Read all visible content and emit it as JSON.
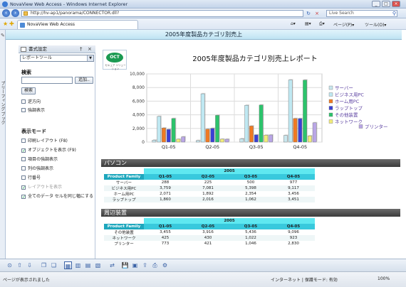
{
  "window": {
    "title": "NovaView Web Access - Windows Internet Explorer"
  },
  "address": {
    "url": "http://hv-ap1/panorama/CONNECTOR.dll?",
    "search_placeholder": "Live Search"
  },
  "tabbar": {
    "tab_label": "NovaView Web Access",
    "page_menu": "ページ(P)",
    "tools_menu": "ツール(O)"
  },
  "header": {
    "title": "2005年度製品カテゴリ別売上"
  },
  "leftstrip": {
    "label": "ブリーフィング ブック"
  },
  "panel": {
    "title": "書式設定",
    "pin": "†",
    "close": "×",
    "select_value": "レポートツール",
    "search_heading": "検索",
    "add_button": "追加..",
    "search_button": "検索",
    "opt_reverse": "逆方向",
    "opt_highlight": "強調表示",
    "mode_heading": "表示モード",
    "modes": [
      {
        "label": "印刷レイアウト (F8)",
        "checked": false,
        "dim": false
      },
      {
        "label": "オブジェクトを表示 (F9)",
        "checked": true,
        "dim": false
      },
      {
        "label": "項目の強調表示",
        "checked": false,
        "dim": false
      },
      {
        "label": "列の強調表示",
        "checked": false,
        "dim": false
      },
      {
        "label": "行番号",
        "checked": false,
        "dim": false
      },
      {
        "label": "レイアウトを表示",
        "checked": true,
        "dim": true
      },
      {
        "label": "全てのデータ セルを同じ幅にする",
        "checked": true,
        "dim": false
      }
    ]
  },
  "report": {
    "logo_text": "OCT",
    "logo_sub": "セキュア ソリューション",
    "title": "2005年度製品カテゴリ別売上レポート"
  },
  "chart_data": {
    "type": "bar",
    "categories": [
      "Q1-05",
      "Q2-05",
      "Q3-05",
      "Q4-05"
    ],
    "yticks": [
      "0",
      "2,000",
      "4,000",
      "6,000",
      "8,000",
      "10,000"
    ],
    "ylim": [
      0,
      10000
    ],
    "series": [
      {
        "name": "サーバー",
        "color": "#c9e7ee",
        "values": [
          288,
          225,
          500,
          977
        ]
      },
      {
        "name": "ビジネス用PC",
        "color": "#bfe8f2",
        "values": [
          3759,
          7081,
          5398,
          9117
        ]
      },
      {
        "name": "ホーム用PC",
        "color": "#f07a22",
        "values": [
          2071,
          1892,
          2354,
          3456
        ]
      },
      {
        "name": "ラップトップ",
        "color": "#3a3fd6",
        "values": [
          1860,
          2016,
          1062,
          3451
        ]
      },
      {
        "name": "その他装置",
        "color": "#2cc46c",
        "values": [
          3455,
          3916,
          5436,
          9096
        ]
      },
      {
        "name": "ネットワーク",
        "color": "#f2ec7a",
        "values": [
          425,
          430,
          1022,
          923
        ]
      },
      {
        "name": "プリンター",
        "color": "#b9a6e6",
        "values": [
          773,
          421,
          1046,
          2830
        ]
      }
    ],
    "legend_position": "right"
  },
  "tables": [
    {
      "band": "パソコン",
      "year": "2005",
      "corner": "Product Family",
      "quarters": [
        "Q1-05",
        "Q2-05",
        "Q3-05",
        "Q4-05"
      ],
      "rows": [
        {
          "label": "サーバー",
          "values": [
            "288",
            "225",
            "500",
            "977"
          ]
        },
        {
          "label": "ビジネス用PC",
          "values": [
            "3,759",
            "7,081",
            "5,398",
            "9,117"
          ]
        },
        {
          "label": "ホーム用PC",
          "values": [
            "2,071",
            "1,892",
            "2,354",
            "3,456"
          ]
        },
        {
          "label": "ラップトップ",
          "values": [
            "1,860",
            "2,016",
            "1,062",
            "3,451"
          ]
        }
      ]
    },
    {
      "band": "周辺装置",
      "year": "2005",
      "corner": "Product Family",
      "quarters": [
        "Q1-05",
        "Q2-05",
        "Q3-05",
        "Q4-05"
      ],
      "rows": [
        {
          "label": "その他装置",
          "values": [
            "3,455",
            "3,916",
            "5,436",
            "9,096"
          ]
        },
        {
          "label": "ネットワーク",
          "values": [
            "425",
            "430",
            "1,022",
            "923"
          ]
        },
        {
          "label": "プリンター",
          "values": [
            "773",
            "421",
            "1,046",
            "2,830"
          ]
        }
      ]
    }
  ],
  "status": {
    "left": "ページが表示されました",
    "zone": "インターネット | 保護モード: 有効",
    "zoom": "100%"
  }
}
